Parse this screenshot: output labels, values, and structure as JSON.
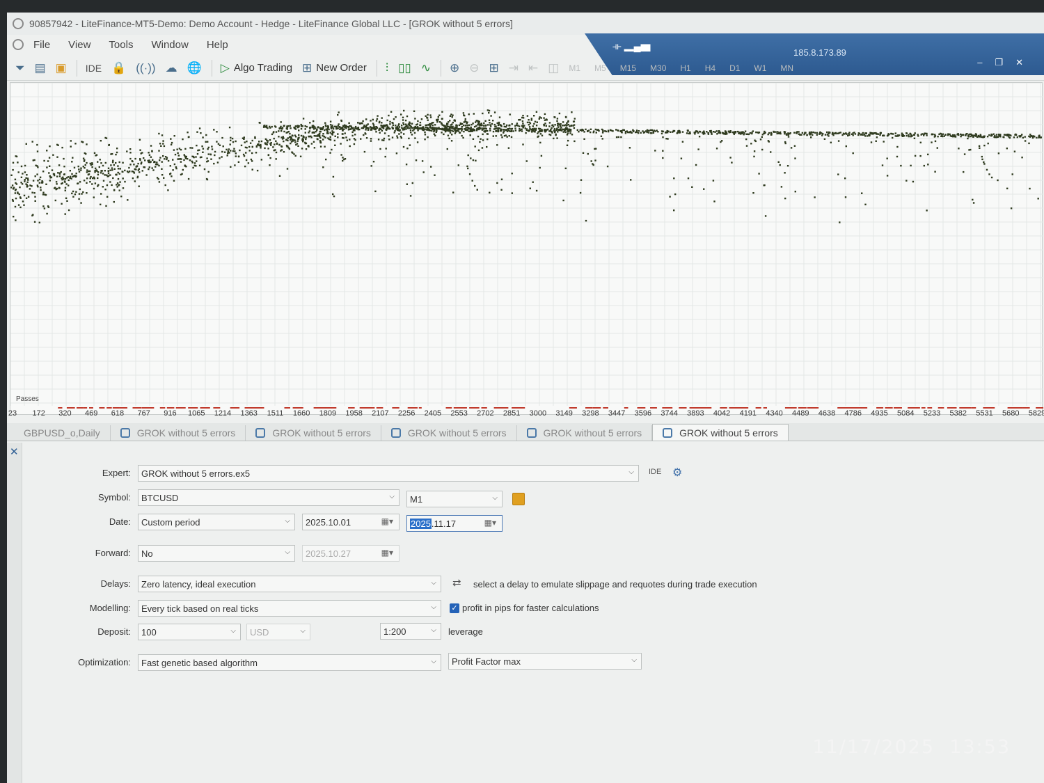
{
  "window": {
    "title": "90857942 - LiteFinance-MT5-Demo: Demo Account - Hedge - LiteFinance Global LLC - [GROK without 5 errors]",
    "ip": "185.8.173.89"
  },
  "menu": [
    "File",
    "View",
    "Tools",
    "Window",
    "Help"
  ],
  "toolbar": {
    "ide": "IDE",
    "algo_trading": "Algo Trading",
    "new_order": "New Order",
    "timeframes": [
      "M1",
      "M5",
      "M15",
      "M30",
      "H1",
      "H4",
      "D1",
      "W1",
      "MN"
    ]
  },
  "chart_data": {
    "type": "scatter",
    "xlabel": "Passes",
    "x_ticks": [
      "23",
      "172",
      "320",
      "469",
      "618",
      "767",
      "916",
      "1065",
      "1214",
      "1363",
      "1511",
      "1660",
      "1809",
      "1958",
      "2107",
      "2256",
      "2405",
      "2553",
      "2702",
      "2851",
      "3000",
      "3149",
      "3298",
      "3447",
      "3596",
      "3744",
      "3893",
      "4042",
      "4191",
      "4340",
      "4489",
      "4638",
      "4786",
      "4935",
      "5084",
      "5233",
      "5382",
      "5531",
      "5680",
      "5829"
    ],
    "x_range": [
      23,
      5829
    ],
    "grid": true,
    "marker_color": "#2f3b1f",
    "error_marker_color": "#c0392b"
  },
  "tabs": [
    "GBPUSD_o,Daily",
    "GROK without 5 errors",
    "GROK without 5 errors",
    "GROK without 5 errors",
    "GROK without 5 errors",
    "GROK without 5 errors"
  ],
  "settings": {
    "expert_label": "Expert:",
    "expert_value": "GROK without 5 errors.ex5",
    "ide": "IDE",
    "symbol_label": "Symbol:",
    "symbol_value": "BTCUSD",
    "timeframe_value": "M1",
    "date_label": "Date:",
    "date_mode": "Custom period",
    "date_from": "2025.10.01",
    "date_to_selected": "2025",
    "date_to_rest": ".11.17",
    "forward_label": "Forward:",
    "forward_value": "No",
    "forward_date": "2025.10.27",
    "delays_label": "Delays:",
    "delays_value": "Zero latency, ideal execution",
    "delays_hint": "select a delay to emulate slippage and requotes during trade execution",
    "modelling_label": "Modelling:",
    "modelling_value": "Every tick based on real ticks",
    "pips_hint": "profit in pips for faster calculations",
    "deposit_label": "Deposit:",
    "deposit_value": "100",
    "currency": "USD",
    "leverage_value": "1:200",
    "leverage_label": "leverage",
    "optimization_label": "Optimization:",
    "optimization_value": "Fast genetic based algorithm",
    "criterion_value": "Profit Factor max"
  },
  "overlay": {
    "date": "11/17/2025",
    "time": "13:53"
  }
}
